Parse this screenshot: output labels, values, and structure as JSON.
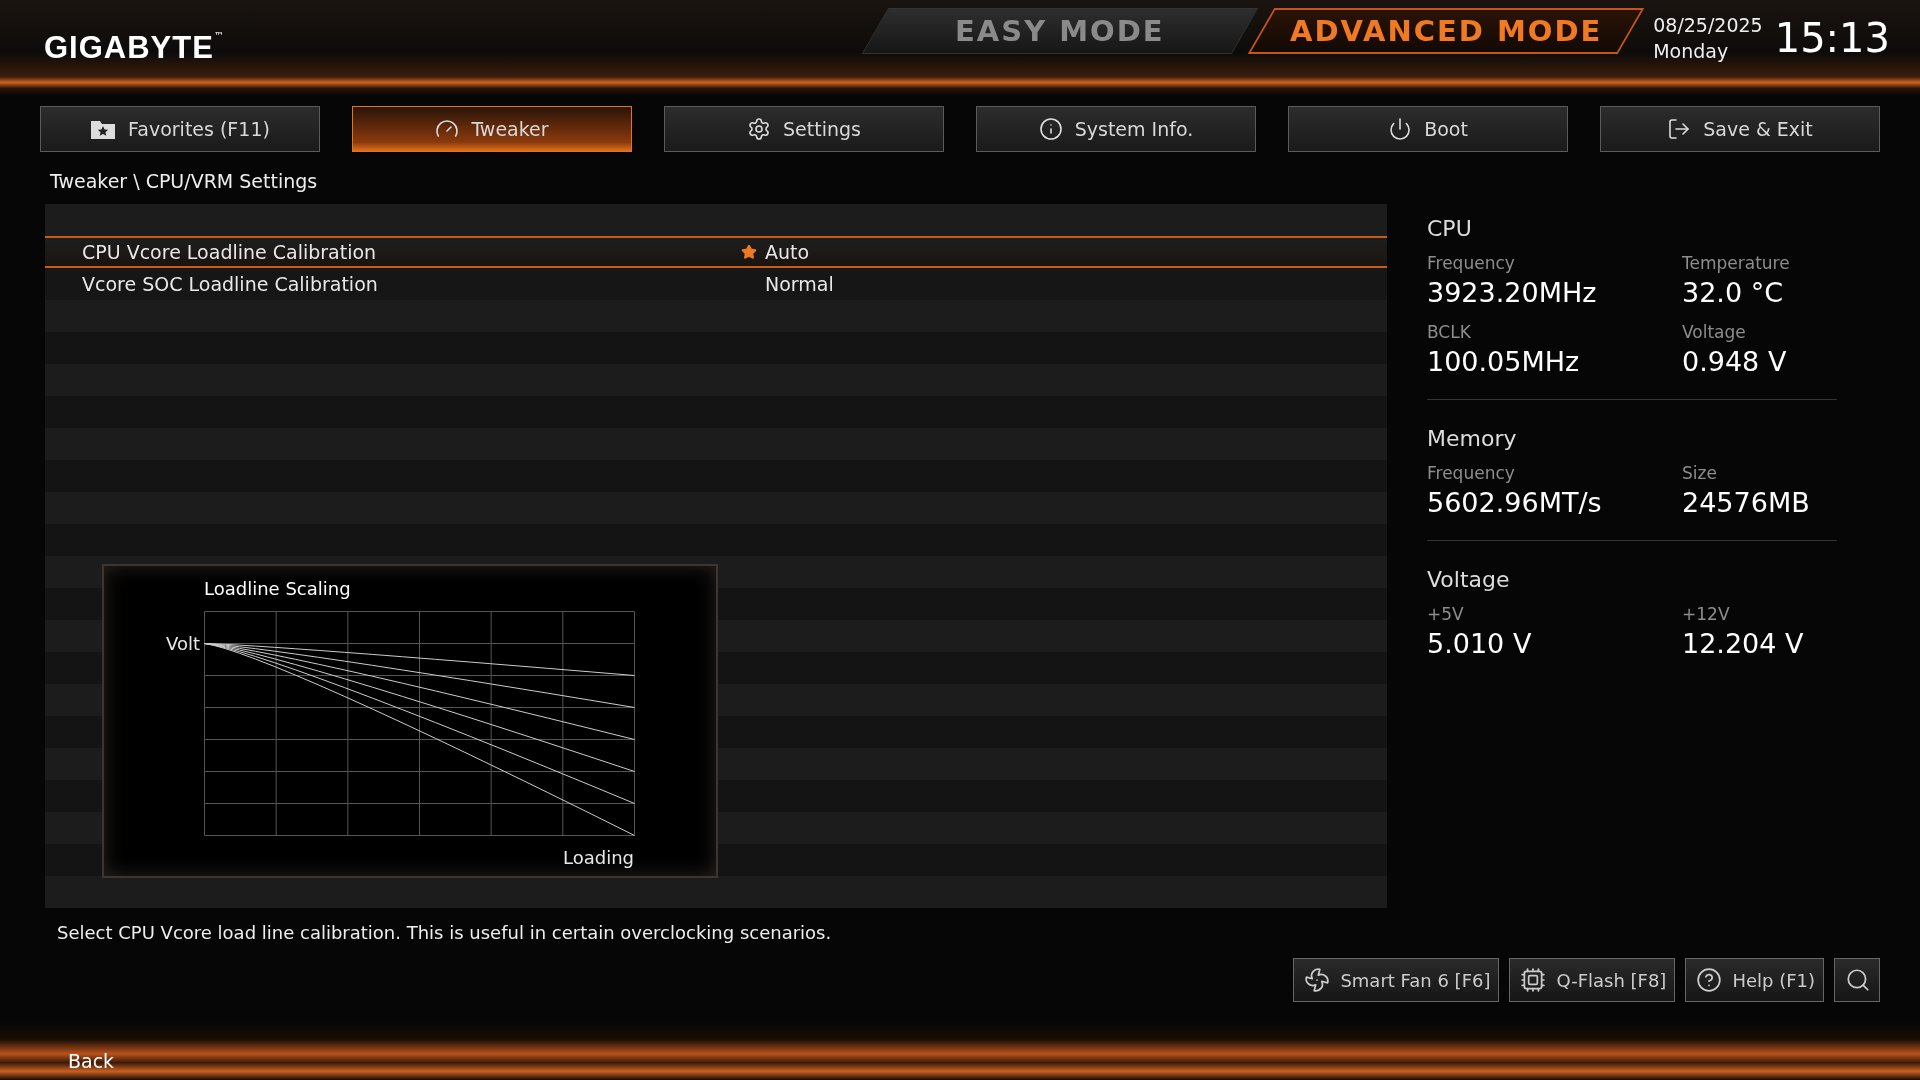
{
  "brand": {
    "logo": "GIGABYTE",
    "trademark": "™"
  },
  "modes": [
    {
      "label": "EASY MODE",
      "selected": false
    },
    {
      "label": "ADVANCED MODE",
      "selected": true
    }
  ],
  "clock": {
    "date": "08/25/2025",
    "weekday": "Monday",
    "time": "15:13"
  },
  "tabs": [
    {
      "label": "Favorites (F11)",
      "selected": false
    },
    {
      "label": "Tweaker",
      "selected": true
    },
    {
      "label": "Settings",
      "selected": false
    },
    {
      "label": "System Info.",
      "selected": false
    },
    {
      "label": "Boot",
      "selected": false
    },
    {
      "label": "Save & Exit",
      "selected": false
    }
  ],
  "breadcrumb": "Tweaker \\ CPU/VRM Settings",
  "settings": [
    {
      "name": "CPU Vcore Loadline Calibration",
      "value": "Auto",
      "starred": true,
      "selected": true
    },
    {
      "name": "Vcore SOC Loadline Calibration",
      "value": "Normal",
      "starred": false,
      "selected": false
    }
  ],
  "graph": {
    "title": "Loadline Scaling",
    "y_label": "Volt",
    "x_label": "Loading"
  },
  "monitor": [
    {
      "title": "CPU",
      "items": [
        {
          "label": "Frequency",
          "value": "3923.20MHz"
        },
        {
          "label": "Temperature",
          "value": "32.0 °C"
        },
        {
          "label": "BCLK",
          "value": "100.05MHz"
        },
        {
          "label": "Voltage",
          "value": "0.948 V"
        }
      ]
    },
    {
      "title": "Memory",
      "items": [
        {
          "label": "Frequency",
          "value": "5602.96MT/s"
        },
        {
          "label": "Size",
          "value": "24576MB"
        }
      ]
    },
    {
      "title": "Voltage",
      "items": [
        {
          "label": "+5V",
          "value": "5.010 V"
        },
        {
          "label": "+12V",
          "value": "12.204 V"
        }
      ]
    }
  ],
  "help_text": "Select CPU Vcore load line calibration. This is useful in certain overclocking scenarios.",
  "tools": [
    {
      "label": "Smart Fan 6 [F6]"
    },
    {
      "label": "Q-Flash [F8]"
    },
    {
      "label": "Help (F1)"
    }
  ],
  "back": "Back"
}
